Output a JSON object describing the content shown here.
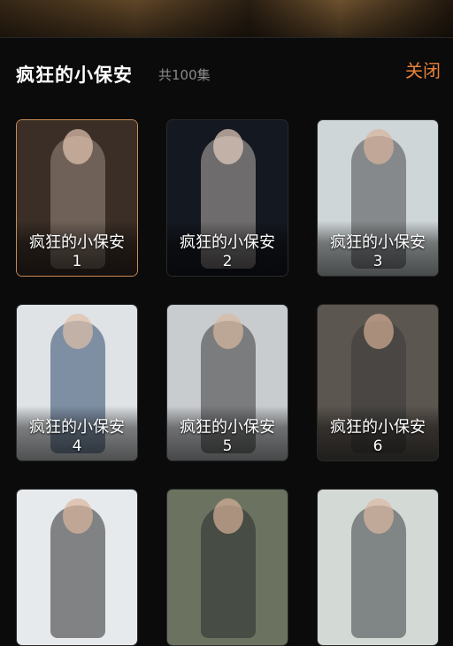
{
  "drama": {
    "title": "疯狂的小保安",
    "episode_count": "共100集",
    "close_label": "关闭"
  },
  "episodes": [
    {
      "title": "疯狂的小保安",
      "number": "1",
      "active": true,
      "bg": "#3a2e26",
      "fig": "#9b8c7f",
      "head": "#e2c4b0"
    },
    {
      "title": "疯狂的小保安",
      "number": "2",
      "active": false,
      "bg": "#141820",
      "fig": "#b9b3ad",
      "head": "#e6cfc0"
    },
    {
      "title": "疯狂的小保安",
      "number": "3",
      "active": false,
      "bg": "#cfd6d8",
      "fig": "#4a4a4c",
      "head": "#d8b49c"
    },
    {
      "title": "疯狂的小保安",
      "number": "4",
      "active": false,
      "bg": "#dfe3e6",
      "fig": "#2e4a6e",
      "head": "#e0bfa6"
    },
    {
      "title": "疯狂的小保安",
      "number": "5",
      "active": false,
      "bg": "#c9cccf",
      "fig": "#3a3a3c",
      "head": "#d9b8a0"
    },
    {
      "title": "疯狂的小保安",
      "number": "6",
      "active": false,
      "bg": "#5c5650",
      "fig": "#3b3a38",
      "head": "#d3ad93"
    },
    {
      "title": "",
      "number": "",
      "active": false,
      "bg": "#e7eaec",
      "fig": "#2c2c2e",
      "head": "#dcb79d"
    },
    {
      "title": "",
      "number": "",
      "active": false,
      "bg": "#6b7360",
      "fig": "#2a2b2d",
      "head": "#d5b198"
    },
    {
      "title": "",
      "number": "",
      "active": false,
      "bg": "#d3dad6",
      "fig": "#3d3f44",
      "head": "#dcb8a0"
    }
  ]
}
